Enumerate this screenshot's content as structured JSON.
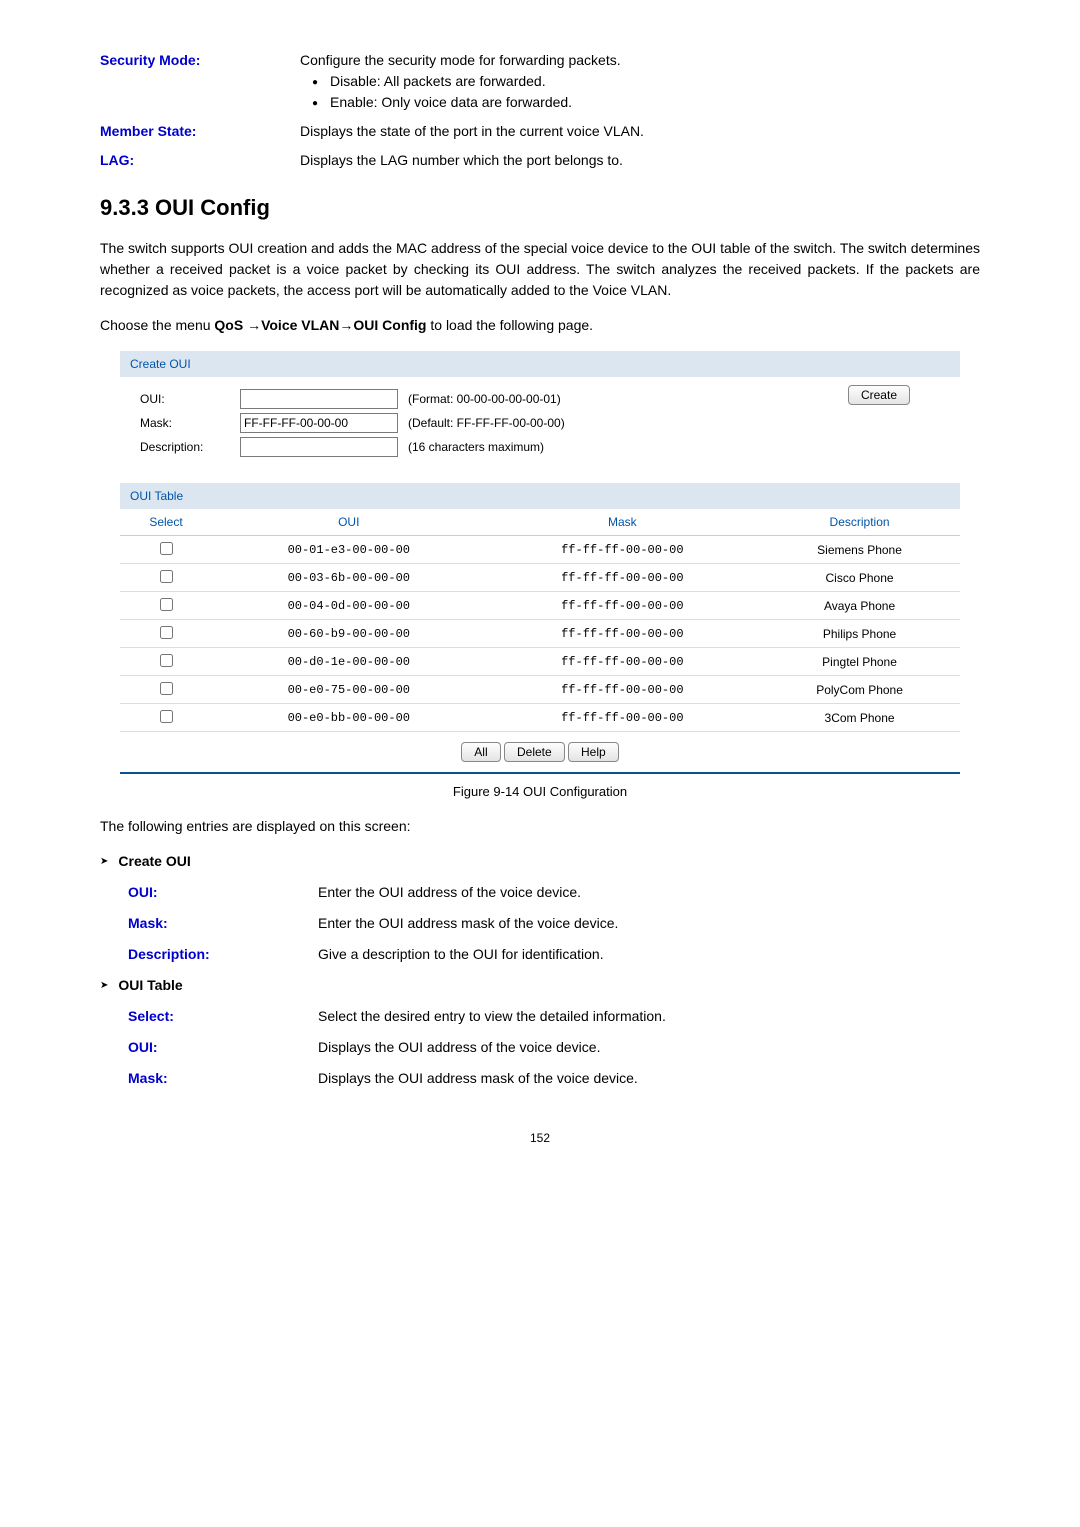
{
  "top_fields": {
    "security_mode": {
      "label": "Security Mode:",
      "desc": "Configure the security mode for forwarding packets.",
      "bullets": [
        "Disable: All packets are forwarded.",
        "Enable: Only voice data are forwarded."
      ]
    },
    "member_state": {
      "label": "Member State:",
      "desc": "Displays the state of the port in the current voice VLAN."
    },
    "lag": {
      "label": "LAG:",
      "desc": "Displays the LAG number which the port belongs to."
    }
  },
  "section": {
    "number_title": "9.3.3 OUI Config",
    "para1": "The switch supports OUI creation and adds the MAC address of the special voice device to the OUI table of the switch. The switch determines whether a received packet is a voice packet by checking its OUI address. The switch analyzes the received packets. If the packets are recognized as voice packets, the access port will be automatically added to the Voice VLAN.",
    "para2_parts": {
      "a": "Choose the menu ",
      "b": "QoS →Voice VLAN→OUI Config",
      "c": " to load the following page."
    }
  },
  "create_oui": {
    "header": "Create OUI",
    "oui_label": "OUI:",
    "oui_value": "",
    "oui_hint": "(Format: 00-00-00-00-00-01)",
    "mask_label": "Mask:",
    "mask_value": "FF-FF-FF-00-00-00",
    "mask_hint": "(Default: FF-FF-FF-00-00-00)",
    "desc_label": "Description:",
    "desc_value": "",
    "desc_hint": "(16 characters maximum)",
    "create_btn": "Create"
  },
  "oui_table": {
    "header": "OUI Table",
    "cols": {
      "select": "Select",
      "oui": "OUI",
      "mask": "Mask",
      "desc": "Description"
    },
    "rows": [
      {
        "oui": "00-01-e3-00-00-00",
        "mask": "ff-ff-ff-00-00-00",
        "desc": "Siemens Phone"
      },
      {
        "oui": "00-03-6b-00-00-00",
        "mask": "ff-ff-ff-00-00-00",
        "desc": "Cisco Phone"
      },
      {
        "oui": "00-04-0d-00-00-00",
        "mask": "ff-ff-ff-00-00-00",
        "desc": "Avaya Phone"
      },
      {
        "oui": "00-60-b9-00-00-00",
        "mask": "ff-ff-ff-00-00-00",
        "desc": "Philips Phone"
      },
      {
        "oui": "00-d0-1e-00-00-00",
        "mask": "ff-ff-ff-00-00-00",
        "desc": "Pingtel Phone"
      },
      {
        "oui": "00-e0-75-00-00-00",
        "mask": "ff-ff-ff-00-00-00",
        "desc": "PolyCom Phone"
      },
      {
        "oui": "00-e0-bb-00-00-00",
        "mask": "ff-ff-ff-00-00-00",
        "desc": "3Com Phone"
      }
    ],
    "buttons": {
      "all": "All",
      "delete": "Delete",
      "help": "Help"
    }
  },
  "figure_caption": "Figure 9-14 OUI Configuration",
  "following_entries": "The following entries are displayed on this screen:",
  "groups": {
    "create_oui": {
      "title": "Create OUI",
      "items": {
        "oui": {
          "label": "OUI:",
          "desc": "Enter the OUI address of the voice device."
        },
        "mask": {
          "label": "Mask:",
          "desc": "Enter the OUI address mask of the voice device."
        },
        "description": {
          "label": "Description:",
          "desc": "Give a description to the OUI for identification."
        }
      }
    },
    "oui_table": {
      "title": "OUI Table",
      "items": {
        "select": {
          "label": "Select:",
          "desc": "Select the desired entry to view the detailed information."
        },
        "oui": {
          "label": "OUI:",
          "desc": "Displays the OUI address of the voice device."
        },
        "mask": {
          "label": "Mask:",
          "desc": "Displays the OUI address mask of the voice device."
        }
      }
    }
  },
  "page_number": "152"
}
